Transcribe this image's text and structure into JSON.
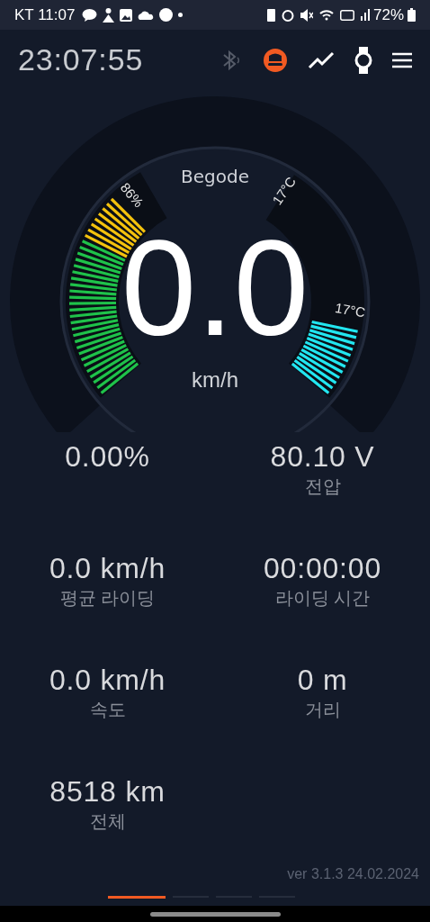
{
  "status_bar": {
    "carrier_time": "KT 11:07",
    "battery": "72%"
  },
  "header": {
    "clock": "23:07:55",
    "icons": [
      {
        "kind": "bluetooth",
        "disabled": true
      },
      {
        "kind": "wheel",
        "disabled": false
      },
      {
        "kind": "chart",
        "disabled": false
      },
      {
        "kind": "watch",
        "disabled": false
      },
      {
        "kind": "menu",
        "disabled": false
      }
    ]
  },
  "gauge": {
    "brand": "Begode",
    "speed": "0.0",
    "unit": "km/h",
    "battery": {
      "label": "86%"
    },
    "temperature_max": "17°C",
    "temperature": {
      "label": "17°C"
    }
  },
  "stats": [
    {
      "value": "0.00%"
    },
    {
      "value": "80.10 V",
      "label": "전압"
    },
    {
      "value": "0.0 km/h",
      "label": "평균 라이딩"
    },
    {
      "value": "00:00:00",
      "label": "라이딩 시간"
    },
    {
      "value": "0.0 km/h",
      "label": "속도"
    },
    {
      "value": "0 m",
      "label": "거리"
    },
    {
      "value": "8518 km",
      "label": "전체"
    }
  ],
  "footer": {
    "version": "ver 3.1.3 24.02.2024",
    "pages": [
      {
        "selected": true
      },
      {
        "selected": false
      },
      {
        "selected": false
      },
      {
        "selected": false
      }
    ]
  }
}
